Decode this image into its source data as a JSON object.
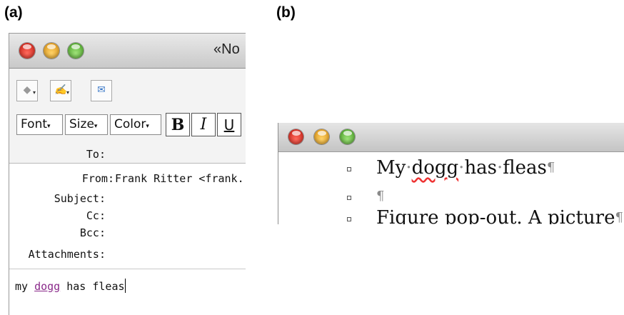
{
  "panel_labels": {
    "a": "(a)",
    "b": "(b)"
  },
  "panel_a": {
    "window_title": "«No",
    "toolbar": {
      "format_buttons": {
        "font": "Font",
        "size": "Size",
        "color": "Color"
      },
      "style_buttons": {
        "bold": "B",
        "italic": "I",
        "underline": "U"
      }
    },
    "headers": {
      "to_label": "To:",
      "from_label": "From:",
      "from_value": "Frank Ritter <frank.r",
      "subject_label": "Subject:",
      "cc_label": "Cc:",
      "bcc_label": "Bcc:",
      "attachments_label": "Attachments:"
    },
    "body": {
      "word1": "my ",
      "misspelled_word": "dogg",
      "rest": " has fleas"
    }
  },
  "panel_b": {
    "rows": [
      {
        "before": "My",
        "misspelled": "dogg",
        "after": "has",
        "last": "fleas",
        "pilcrow": "¶"
      },
      {
        "pilcrow": "¶"
      },
      {
        "text": "Figure pop-out. A picture",
        "pilcrow": "¶"
      }
    ]
  },
  "colors": {
    "close": "#e0443a",
    "minimize": "#f0a92b",
    "zoom": "#6cc24a",
    "misspelled_mail": "#8a2a8a",
    "spell_underline": "#ee3333"
  }
}
